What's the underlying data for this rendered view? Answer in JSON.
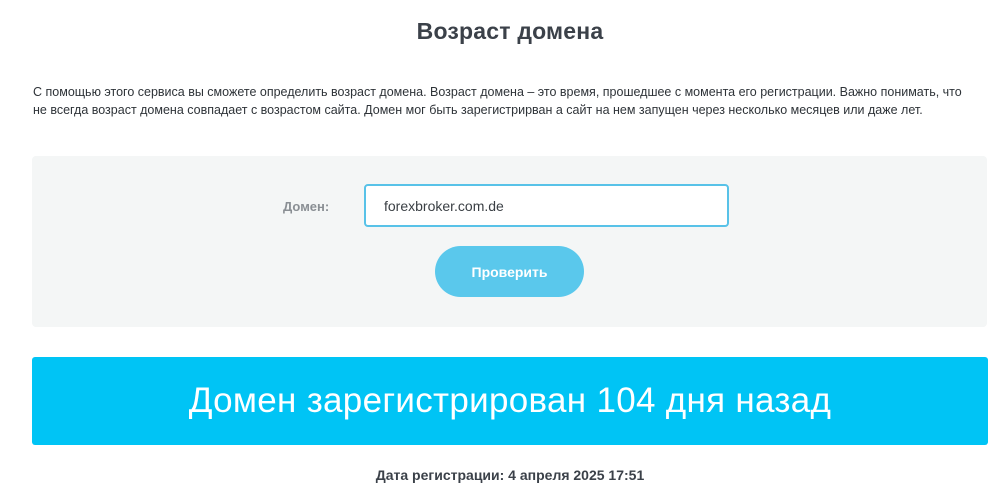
{
  "page": {
    "title": "Возраст домена",
    "description": "С помощью этого сервиса вы сможете определить возраст домена. Возраст домена – это время, прошедшее с момента его регистрации. Важно понимать, что не всегда возраст домена совпадает с возрастом сайта. Домен мог быть зарегистрирван а сайт на нем запущен через несколько месяцев или даже лет."
  },
  "form": {
    "domain_label": "Домен:",
    "domain_value": "forexbroker.com.de",
    "check_button_label": "Проверить"
  },
  "result": {
    "banner_text": "Домен зарегистрирован 104 дня назад",
    "registration_date_text": "Дата регистрации: 4 апреля 2025 17:51"
  },
  "colors": {
    "accent_input_border": "#58c2e8",
    "button_bg": "#5ac8ec",
    "banner_bg": "#00c4f5",
    "panel_bg": "#f4f6f6"
  }
}
